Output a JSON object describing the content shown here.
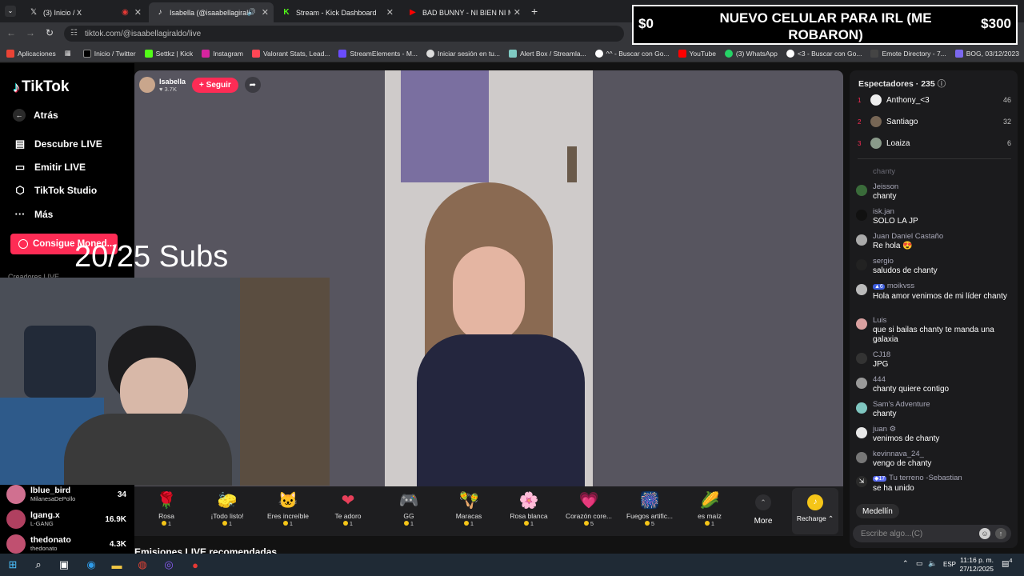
{
  "browser": {
    "tabs": [
      {
        "label": "(3) Inicio / X",
        "icon": "x-icon"
      },
      {
        "label": "Isabella (@isaabellagiraldo",
        "icon": "tiktok-icon"
      },
      {
        "label": "Stream - Kick Dashboard",
        "icon": "kick-icon"
      },
      {
        "label": "BAD BUNNY - NI BIEN NI MAL",
        "icon": "youtube-icon"
      }
    ],
    "url": "tiktok.com/@isaabellagiraldo/live",
    "bookmarks": [
      "Aplicaciones",
      "Inicio / Twitter",
      "Settkz | Kick",
      "Instagram",
      "Valorant Stats, Lead...",
      "StreamElements - M...",
      "Iniciar sesión en tu...",
      "Alert Box / Streamla...",
      "^^ - Buscar con Go...",
      "YouTube",
      "(3) WhatsApp",
      "<3 - Buscar con Go...",
      "Emote Directory - 7...",
      "BOG, 03/12/2023"
    ]
  },
  "banner": {
    "left": "$0",
    "text": "NUEVO CELULAR PARA IRL (ME ROBARON)",
    "right": "$300"
  },
  "sidebar": {
    "logo": "TikTok",
    "back": "Atrás",
    "items": [
      "Descubre LIVE",
      "Emitir LIVE",
      "TikTok Studio",
      "Más"
    ],
    "coins": "Consigue Moned...",
    "creators_label": "Creadores LIVE"
  },
  "overlay": {
    "subs": "20/25 Subs"
  },
  "streamer": {
    "name": "Isabella",
    "likes": "3.7K",
    "follow": "+ Seguir"
  },
  "leaderboard": [
    {
      "name": "lblue_bird",
      "sub": "MilanesaDePollo",
      "count": "34"
    },
    {
      "name": "lgang.x",
      "sub": "L-GANG",
      "count": "16.9K"
    },
    {
      "name": "thedonato",
      "sub": "thedonato",
      "count": "4.3K"
    }
  ],
  "gifts": [
    {
      "name": "Rosa",
      "price": "1",
      "glyph": "🌹"
    },
    {
      "name": "¡Todo listo!",
      "price": "1",
      "glyph": "🧽"
    },
    {
      "name": "Eres increíble",
      "price": "1",
      "glyph": "🐱"
    },
    {
      "name": "Te adoro",
      "price": "1",
      "glyph": "❤"
    },
    {
      "name": "GG",
      "price": "1",
      "glyph": "🎮"
    },
    {
      "name": "Maracas",
      "price": "1",
      "glyph": "🪇"
    },
    {
      "name": "Rosa blanca",
      "price": "1",
      "glyph": "🌸"
    },
    {
      "name": "Corazón core...",
      "price": "5",
      "glyph": "💗"
    },
    {
      "name": "Fuegos artific...",
      "price": "5",
      "glyph": "🎆"
    },
    {
      "name": "es maíz",
      "price": "1",
      "glyph": "🌽"
    }
  ],
  "gift_more": "More",
  "recharge": "Recharge",
  "recommended": "Emisiones LIVE recomendadas",
  "chat": {
    "viewers_title": "Espectadores · 235",
    "top_viewers": [
      {
        "rank": "1",
        "name": "Anthony_<3",
        "count": "46"
      },
      {
        "rank": "2",
        "name": "Santiago",
        "count": "32"
      },
      {
        "rank": "3",
        "name": "Loaiza",
        "count": "6"
      }
    ],
    "partial": "chanty",
    "messages": [
      {
        "user": "Jeisson",
        "text": "chanty",
        "color": "#3a6b3a"
      },
      {
        "user": "isk.jan",
        "text": "SOLO LA JP",
        "color": "#111111"
      },
      {
        "user": "Juan Daniel Castaño",
        "text": "Re hola 😍",
        "color": "#aaaaaa"
      },
      {
        "user": "sergio",
        "text": "saludos de chanty",
        "color": "#222222"
      },
      {
        "user": "moikvss",
        "text": "Hola amor venimos de mi líder chanty",
        "color": "#bbbbbb"
      },
      {
        "user": "Luis",
        "text": "que si bailas chanty te manda una galaxia",
        "color": "#d9a0a0"
      },
      {
        "user": "CJ18",
        "text": "JPG",
        "color": "#333333"
      },
      {
        "user": "444",
        "text": "chanty quiere contigo",
        "color": "#999999"
      },
      {
        "user": "Sam's Adventure",
        "text": "chanty",
        "color": "#7fc6c0"
      },
      {
        "user": "juan",
        "text": "venimos de chanty",
        "color": "#e8e8e8"
      },
      {
        "user": "kevinnava_24_",
        "text": "vengo de chanty",
        "color": "#777777"
      },
      {
        "user": "Tu terreno -Sebastian",
        "text": "se ha unido",
        "color": "#2a2a2a"
      }
    ],
    "chip": "Medellín",
    "placeholder": "Escribe algo...(C)"
  },
  "taskbar": {
    "time": "11:16 p. m.",
    "date": "27/12/2025",
    "lang": "ESP",
    "notif": "4"
  }
}
